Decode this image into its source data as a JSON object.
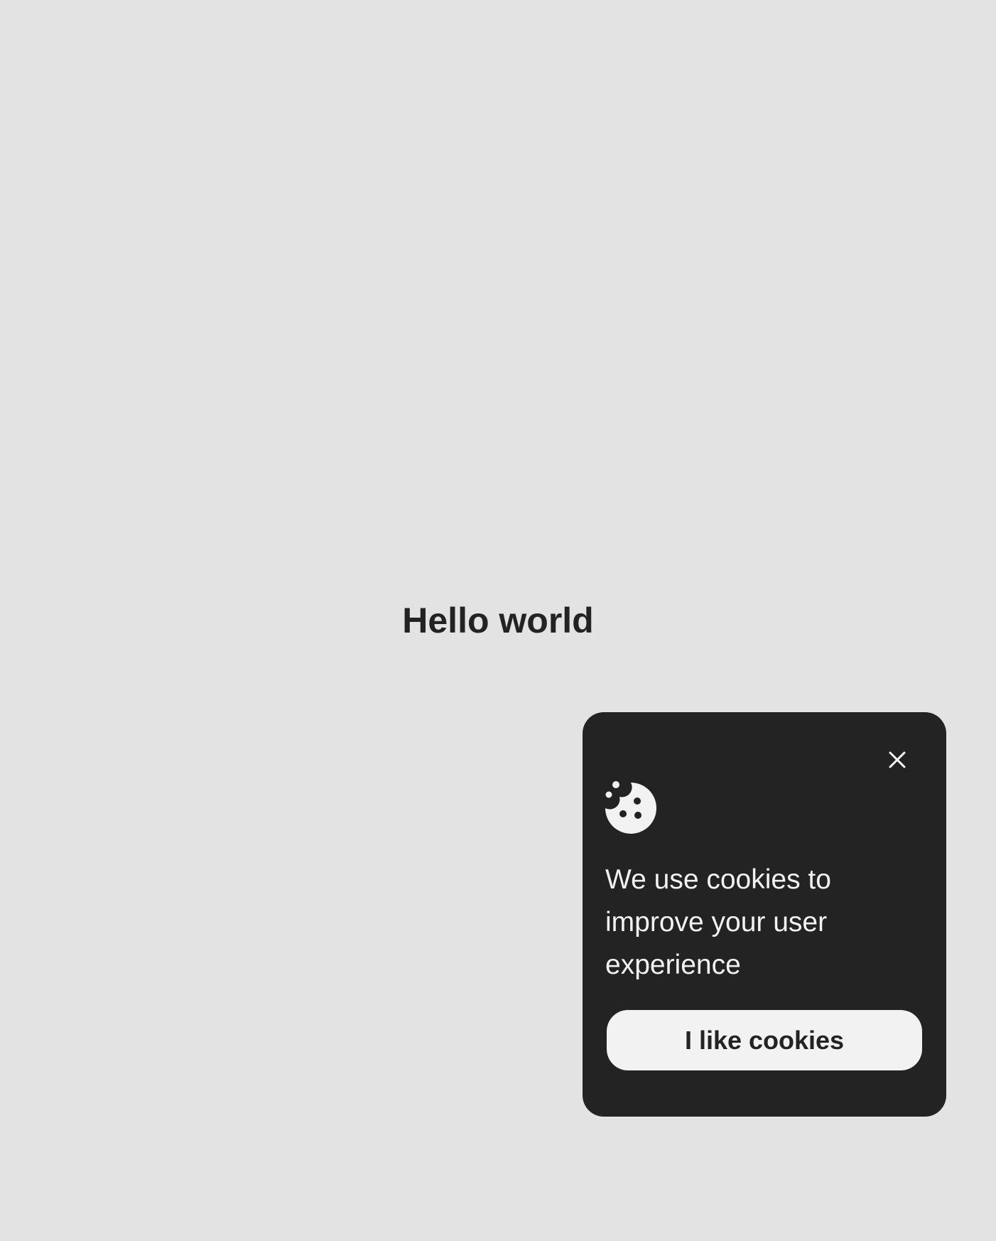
{
  "page": {
    "heading": "Hello world",
    "background_color": "#e3e3e3"
  },
  "cookie_banner": {
    "message": "We use cookies to improve your user experience",
    "accept_label": "I like cookies",
    "close_icon": "close-icon",
    "cookie_icon": "cookie-icon",
    "background_color": "#232323",
    "button_color": "#f2f2f2"
  }
}
